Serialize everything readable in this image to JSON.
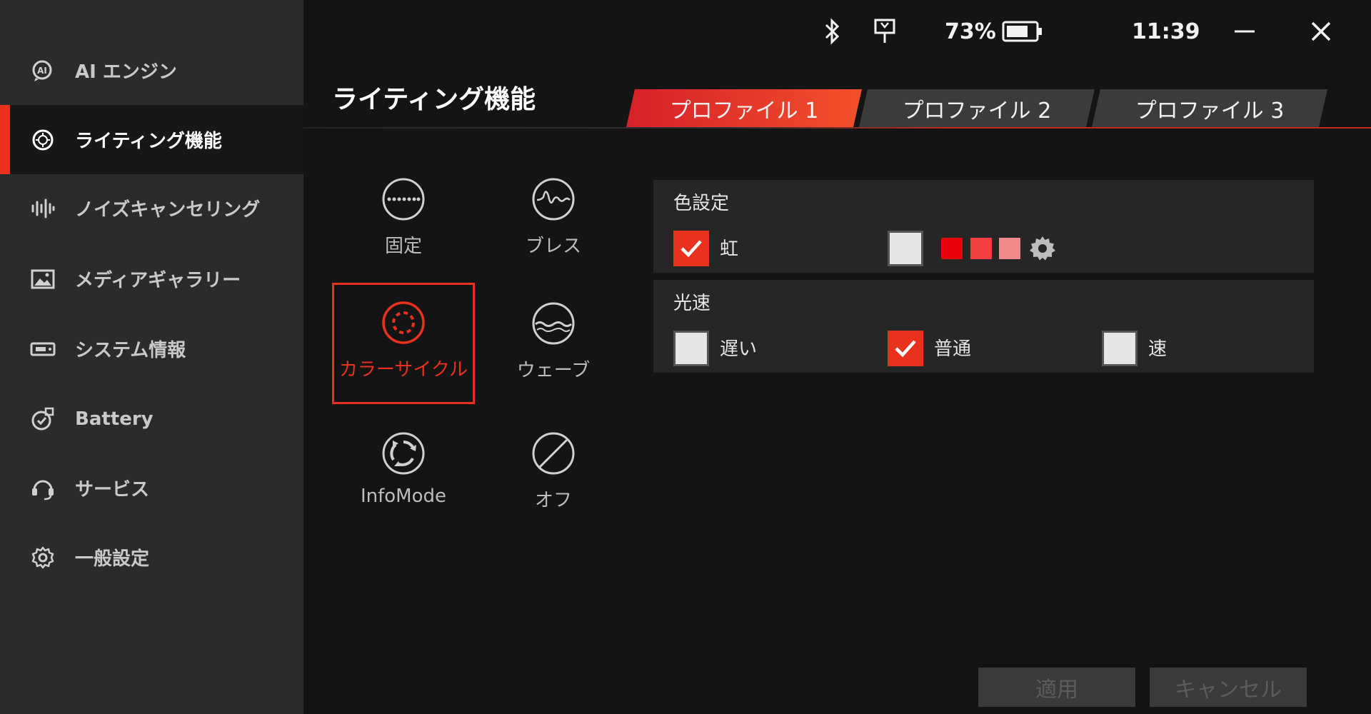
{
  "sidebar": {
    "items": [
      {
        "label": "AI エンジン",
        "icon": "ai-icon"
      },
      {
        "label": "ライティング機能",
        "icon": "lighting-icon",
        "active": true
      },
      {
        "label": "ノイズキャンセリング",
        "icon": "waveform-icon"
      },
      {
        "label": "メディアギャラリー",
        "icon": "image-icon"
      },
      {
        "label": "システム情報",
        "icon": "system-icon"
      },
      {
        "label": "Battery",
        "icon": "battery-icon"
      },
      {
        "label": "サービス",
        "icon": "headset-icon"
      },
      {
        "label": "一般設定",
        "icon": "gear-icon"
      }
    ]
  },
  "topbar": {
    "battery_percent": "73%",
    "battery_level": 0.73,
    "time": "11:39"
  },
  "page": {
    "title": "ライティング機能"
  },
  "tabs": [
    {
      "label": "プロファイル 1",
      "active": true
    },
    {
      "label": "プロファイル 2"
    },
    {
      "label": "プロファイル 3"
    }
  ],
  "effects": [
    {
      "label": "固定",
      "icon": "static-icon"
    },
    {
      "label": "ブレス",
      "icon": "breath-icon"
    },
    {
      "label": "カラーサイクル",
      "icon": "color-cycle-icon",
      "selected": true
    },
    {
      "label": "ウェーブ",
      "icon": "wave-icon"
    },
    {
      "label": "InfoMode",
      "icon": "infomode-icon"
    },
    {
      "label": "オフ",
      "icon": "off-icon"
    }
  ],
  "color_settings": {
    "title": "色設定",
    "rainbow_label": "虹",
    "rainbow_checked": true,
    "custom_checked": false,
    "swatches": [
      "#e8000a",
      "#f24040",
      "#f28c8c"
    ]
  },
  "speed": {
    "title": "光速",
    "options": [
      {
        "label": "遅い",
        "checked": false
      },
      {
        "label": "普通",
        "checked": true
      },
      {
        "label": "速",
        "checked": false
      }
    ]
  },
  "buttons": {
    "apply": "適用",
    "cancel": "キャンセル"
  },
  "colors": {
    "accent": "#e8321e",
    "sidebar_bg": "#2b2b2b",
    "main_bg": "#141414"
  }
}
